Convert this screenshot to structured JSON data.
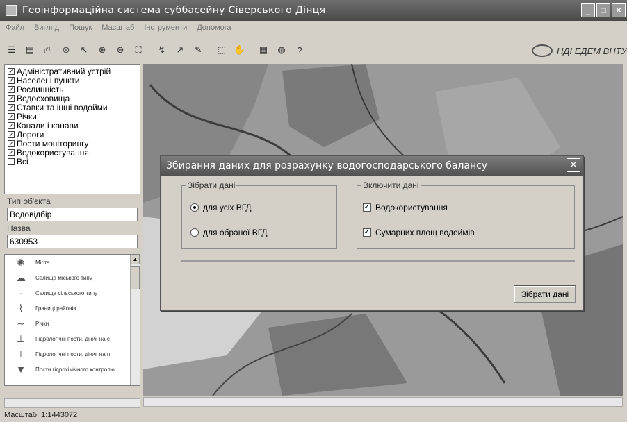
{
  "window": {
    "title": "Геоінформаційна система суббасейну Сіверського Дінця"
  },
  "menu": [
    "Файл",
    "Вигляд",
    "Пошук",
    "Масштаб",
    "Інструменти",
    "Допомога"
  ],
  "toolbar_icons": [
    "layers-icon",
    "database-icon",
    "print-icon",
    "binoculars-icon",
    "select-icon",
    "zoom-in-icon",
    "zoom-out-icon",
    "zoom-extent-icon",
    "measure-icon",
    "identify-icon",
    "edit-icon",
    "select-area-icon",
    "pan-icon",
    "report-icon",
    "globe-icon",
    "help-icon"
  ],
  "brand": {
    "text": "НДІ ЕДЕМ ВНТУ"
  },
  "layers": [
    {
      "label": "Адміністративний устрій",
      "checked": true
    },
    {
      "label": "Населені пункти",
      "checked": true
    },
    {
      "label": "Рослинність",
      "checked": true
    },
    {
      "label": "Водосховища",
      "checked": true
    },
    {
      "label": "Ставки та інші водойми",
      "checked": true
    },
    {
      "label": "Річки",
      "checked": true
    },
    {
      "label": "Канали і канави",
      "checked": true
    },
    {
      "label": "Дороги",
      "checked": true
    },
    {
      "label": "Пости моніторингу",
      "checked": true
    },
    {
      "label": "Водокористування",
      "checked": true
    },
    {
      "label": "Всі",
      "checked": false
    }
  ],
  "object_info": {
    "type_label": "Тип об'єкта",
    "type_value": "Водовідбір",
    "name_label": "Назва",
    "name_value": "630953"
  },
  "legend": [
    "Міста",
    "Селища міського типу",
    "Селища сільського типу",
    "Границі районів",
    "Річки",
    "Гідрологічні пости, діючі на с",
    "Гідрологічні пости, діючі на п",
    "Пости гідрохімічного контролю"
  ],
  "status": {
    "scale": "Масштаб: 1:1443072"
  },
  "dialog": {
    "title": "Збирання даних для розрахунку водогосподарського балансу",
    "collect_group": "Зібрати дані",
    "radio_all": "для усіх ВГД",
    "radio_selected": "для обраної ВГД",
    "include_group": "Включити дані",
    "check_water_use": "Водокористування",
    "check_reservoirs": "Сумарних площ водоймів",
    "collect_button": "Зібрати дані"
  }
}
